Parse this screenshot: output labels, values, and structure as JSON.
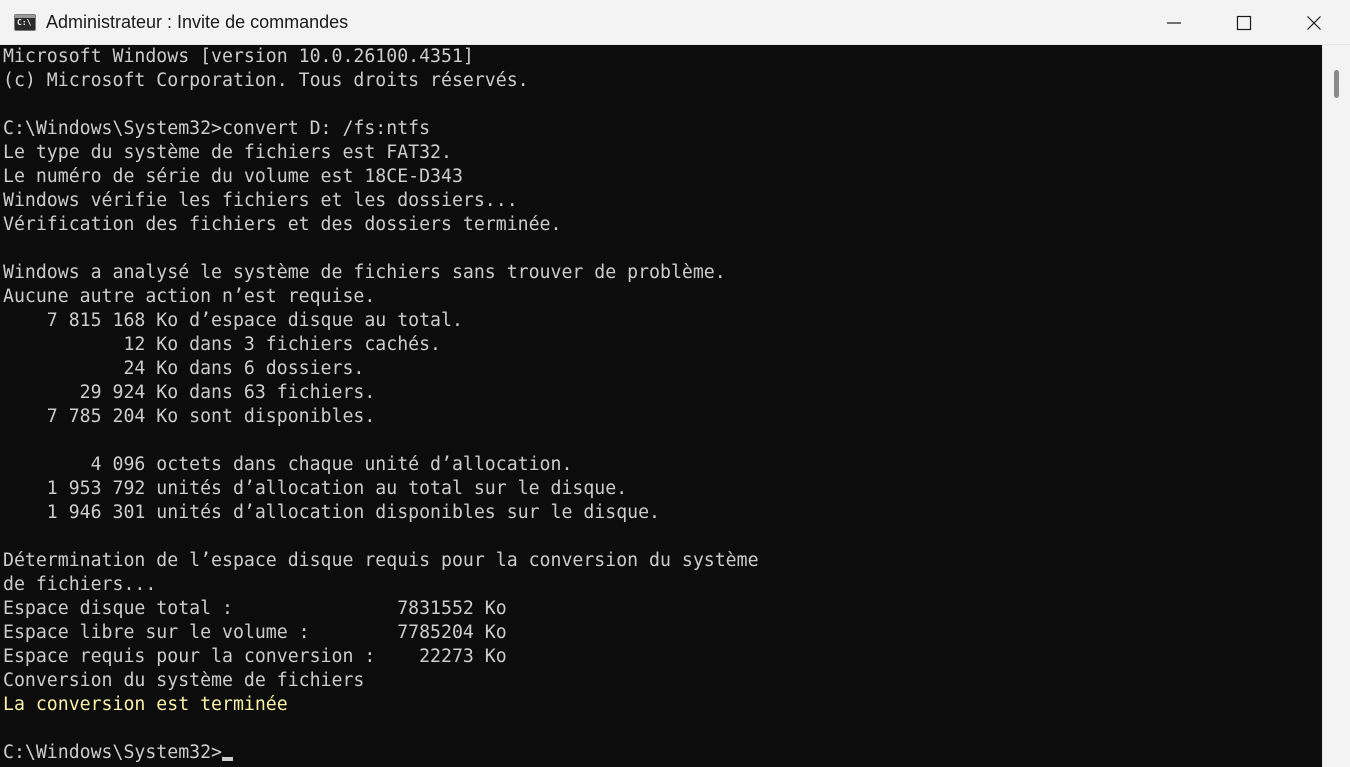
{
  "window": {
    "title": "Administrateur : Invite de commandes",
    "icon": "cmd-icon",
    "icon_glyph": "C:\\"
  },
  "controls": {
    "minimize": "minimize-icon",
    "maximize": "maximize-icon",
    "close": "close-icon"
  },
  "colors": {
    "console_background": "#0c0c0c",
    "console_text": "#cccccc",
    "success_text": "#f9f1a5",
    "titlebar_background": "#f3f3f3"
  },
  "console": {
    "lines": [
      "Microsoft Windows [version 10.0.26100.4351]",
      "(c) Microsoft Corporation. Tous droits réservés.",
      "",
      "C:\\Windows\\System32>convert D: /fs:ntfs",
      "Le type du système de fichiers est FAT32.",
      "Le numéro de série du volume est 18CE-D343",
      "Windows vérifie les fichiers et les dossiers...",
      "Vérification des fichiers et des dossiers terminée.",
      "",
      "Windows a analysé le système de fichiers sans trouver de problème.",
      "Aucune autre action n’est requise.",
      "    7 815 168 Ko d’espace disque au total.",
      "           12 Ko dans 3 fichiers cachés.",
      "           24 Ko dans 6 dossiers.",
      "       29 924 Ko dans 63 fichiers.",
      "    7 785 204 Ko sont disponibles.",
      "",
      "        4 096 octets dans chaque unité d’allocation.",
      "    1 953 792 unités d’allocation au total sur le disque.",
      "    1 946 301 unités d’allocation disponibles sur le disque.",
      "",
      "Détermination de l’espace disque requis pour la conversion du système",
      "de fichiers...",
      "Espace disque total :               7831552 Ko",
      "Espace libre sur le volume :        7785204 Ko",
      "Espace requis pour la conversion :    22273 Ko",
      "Conversion du système de fichiers",
      "La conversion est terminée",
      "",
      "C:\\Windows\\System32>"
    ]
  }
}
